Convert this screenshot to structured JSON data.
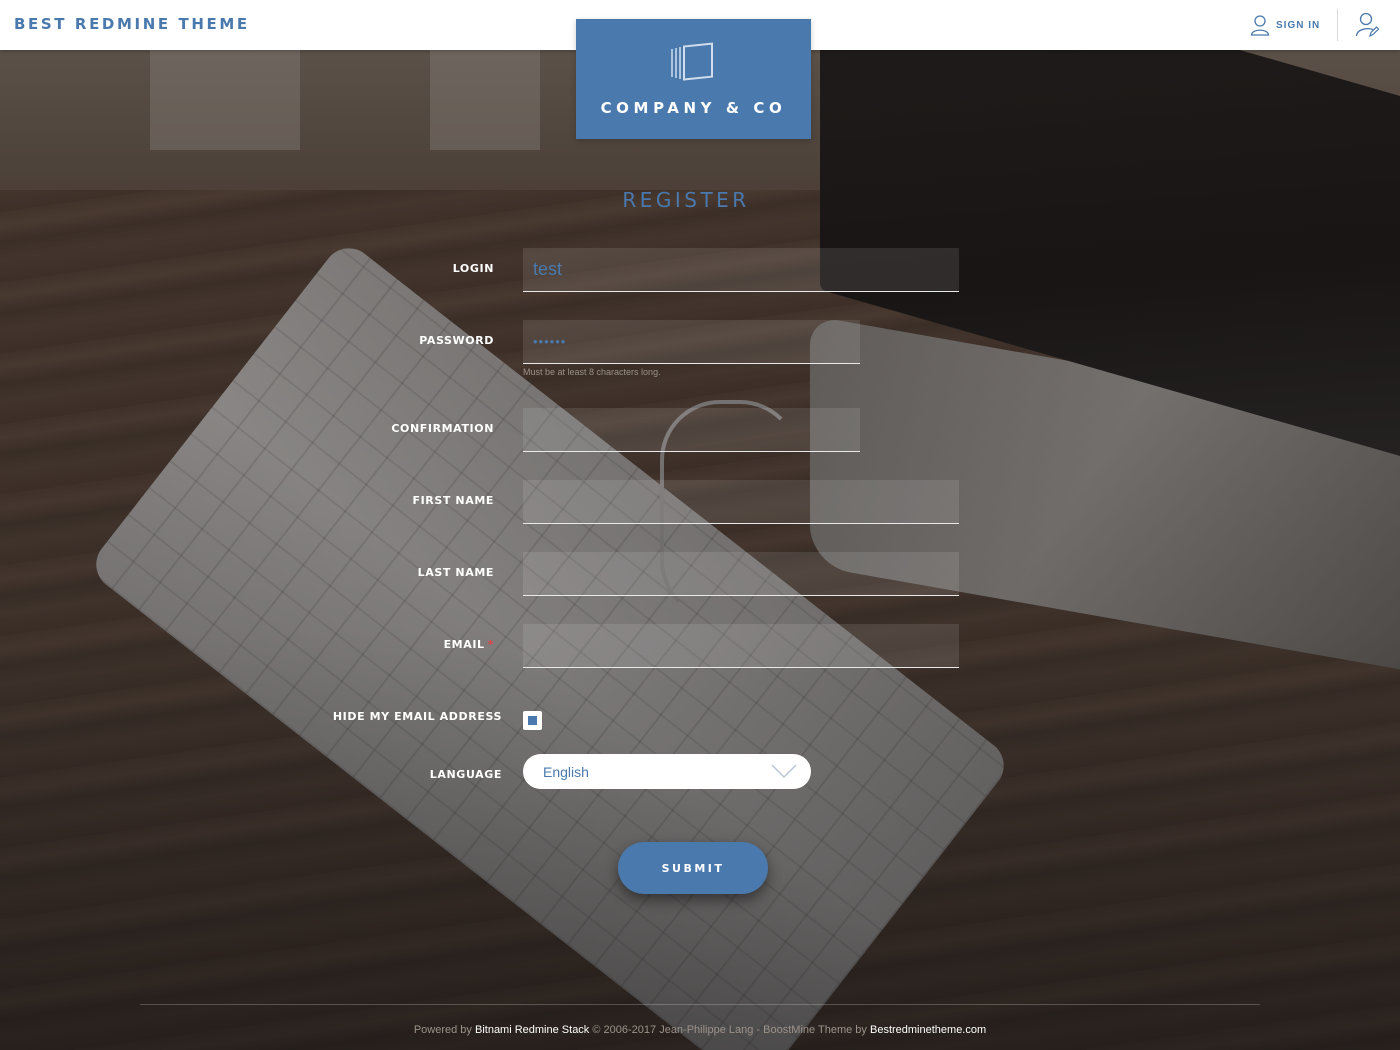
{
  "header": {
    "brand": "BEST REDMINE THEME",
    "signin_label": "SIGN IN",
    "signin_icon": "user-icon",
    "register_icon": "user-edit-icon"
  },
  "logo": {
    "text": "COMPANY & CO",
    "icon": "logo-mark-icon"
  },
  "form": {
    "title": "REGISTER",
    "fields": {
      "login": {
        "label": "LOGIN",
        "value": "test"
      },
      "password": {
        "label": "PASSWORD",
        "value": "••••••",
        "hint": "Must be at least 8 characters long."
      },
      "confirmation": {
        "label": "CONFIRMATION",
        "value": ""
      },
      "first_name": {
        "label": "FIRST NAME",
        "value": ""
      },
      "last_name": {
        "label": "LAST NAME",
        "value": ""
      },
      "email": {
        "label": "EMAIL",
        "required_mark": "*",
        "value": ""
      },
      "hide_email": {
        "label": "HIDE MY EMAIL ADDRESS",
        "checked": true
      },
      "language": {
        "label": "LANGUAGE",
        "value": "English"
      }
    },
    "submit_label": "SUBMIT"
  },
  "footer": {
    "powered_by": "Powered by",
    "stack_link": "Bitnami Redmine Stack",
    "copyright": "© 2006-2017 Jean-Philippe Lang",
    "separator": " - ",
    "theme_text": "BoostMine Theme by",
    "theme_link": "Bestredminetheme.com"
  },
  "colors": {
    "accent": "#4a79ad",
    "header_bg": "#ffffff",
    "label": "#ffffff",
    "required": "#e04848"
  }
}
